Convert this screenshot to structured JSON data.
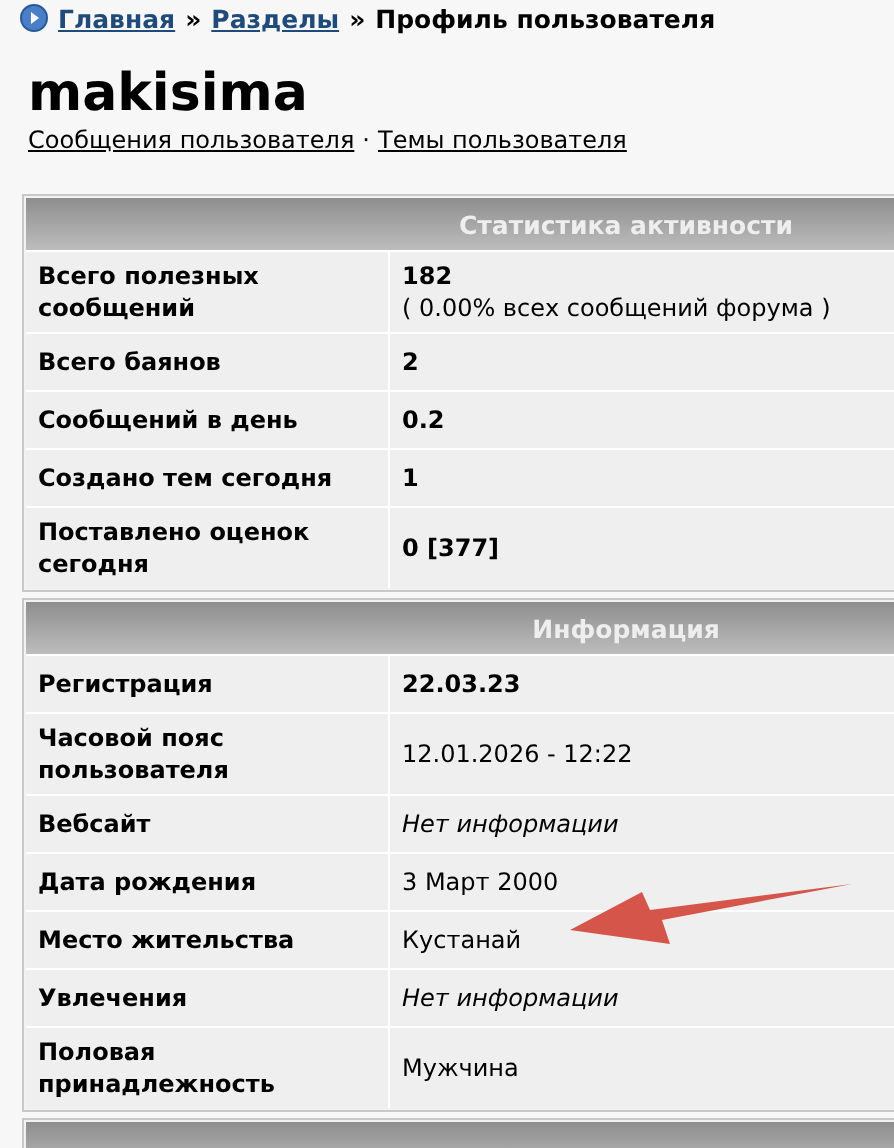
{
  "breadcrumb": {
    "links": [
      "Главная",
      "Разделы"
    ],
    "separator": "»",
    "current": "Профиль пользователя"
  },
  "username": "makisima",
  "user_links": {
    "items": [
      "Сообщения пользователя",
      "Темы пользователя"
    ],
    "separator": "·"
  },
  "sections": [
    {
      "title": "Статистика активности",
      "rows": [
        {
          "label": "Всего полезных сообщений",
          "value": "182",
          "kind": "stat",
          "note": "( 0.00% всех сообщений форума )"
        },
        {
          "label": "Всего баянов",
          "value": "2",
          "kind": "stat"
        },
        {
          "label": "Сообщений в день",
          "value": "0.2",
          "kind": "stat"
        },
        {
          "label": "Создано тем сегодня",
          "value": "1",
          "kind": "stat"
        },
        {
          "label": "Поставлено оценок сегодня",
          "value": "0 [377]",
          "kind": "stat"
        }
      ]
    },
    {
      "title": "Информация",
      "rows": [
        {
          "label": "Регистрация",
          "value": "22.03.23",
          "kind": "stat"
        },
        {
          "label": "Часовой пояс пользователя",
          "value": "12.01.2026 - 12:22",
          "kind": "text"
        },
        {
          "label": "Вебсайт",
          "value": "Нет информации",
          "kind": "missing"
        },
        {
          "label": "Дата рождения",
          "value": "3 Март 2000",
          "kind": "text"
        },
        {
          "label": "Место жительства",
          "value": "Кустанай",
          "kind": "text"
        },
        {
          "label": "Увлечения",
          "value": "Нет информации",
          "kind": "missing"
        },
        {
          "label": "Половая принадлежность",
          "value": "Мужчина",
          "kind": "text"
        }
      ]
    }
  ]
}
